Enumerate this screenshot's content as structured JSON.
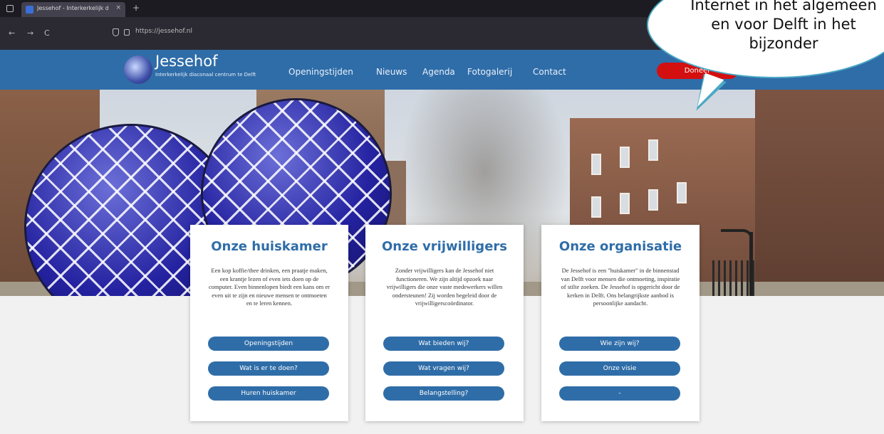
{
  "browser": {
    "tab_title": "Jessehof - Interkerkelijk diaconaal ...",
    "tab_close": "×",
    "new_tab": "+",
    "url": "https://jessehof.nl",
    "nav_back": "←",
    "nav_forward": "→",
    "nav_reload": "C"
  },
  "site": {
    "logo_title": "Jessehof",
    "logo_subtitle": "Interkerkelijk diaconaal centrum te Delft",
    "nav": [
      "Openingstijden",
      "Nieuws",
      "Agenda",
      "Fotogalerij",
      "Contact"
    ],
    "donate": "Doneer"
  },
  "bubble": {
    "line1": "Internet in het algemeen",
    "line2": "en voor Delft in het",
    "line3": "bijzonder"
  },
  "cards": [
    {
      "title": "Onze huiskamer",
      "text": "Een kop koffie/thee drinken, een praatje maken, een krantje lezen of even iets doen op de computer. Even binnenlopen biedt een kans om er even uit te zijn en nieuwe mensen te ontmoeten en te leren kennen.",
      "buttons": [
        "Openingstijden",
        "Wat is er te doen?",
        "Huren huiskamer"
      ]
    },
    {
      "title": "Onze vrijwilligers",
      "text": "Zonder vrijwilligers kan de Jessehof niet functioneren. We zijn altijd opzoek naar vrijwilligers die onze vaste medewerkers willen ondersteunen! Zij worden begeleid door de vrijwilligerscoördinator.",
      "buttons": [
        "Wat bieden wij?",
        "Wat vragen wij?",
        "Belangstelling?"
      ]
    },
    {
      "title": "Onze organisatie",
      "text": "De Jessehof is een \"huiskamer\" in de binnenstad van Delft voor mensen die ontmoeting, inspiratie of stilte zoeken. De Jessehof is opgericht door de kerken in Delft. Ons belangrijkste aanbod is persoonlijke aandacht.",
      "buttons": [
        "Wie zijn wij?",
        "Onze visie",
        "-"
      ]
    }
  ],
  "colors": {
    "brand_blue": "#2f6da8",
    "donate_red": "#d40f0f",
    "bubble_border": "#4aa8c4"
  }
}
